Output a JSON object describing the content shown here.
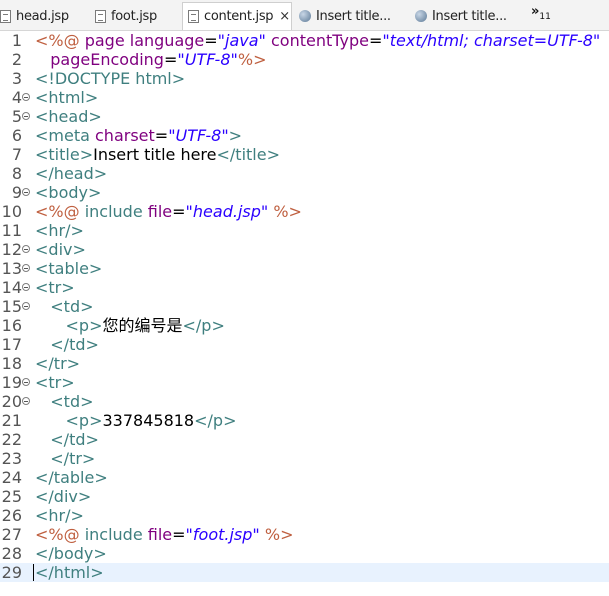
{
  "tabs": [
    {
      "label": "head.jsp",
      "icon": "jsp-file-icon",
      "active": false
    },
    {
      "label": "foot.jsp",
      "icon": "jsp-file-icon",
      "active": false
    },
    {
      "label": "content.jsp",
      "icon": "jsp-file-icon",
      "active": true,
      "close": "×"
    },
    {
      "label": "Insert title...",
      "icon": "browser-globe-icon",
      "active": false
    },
    {
      "label": "Insert title...",
      "icon": "browser-globe-icon",
      "active": false
    }
  ],
  "overflow": {
    "chevron": "»",
    "count": "11"
  },
  "lines": [
    {
      "n": "1",
      "fold": false,
      "tokens": [
        [
          "dir",
          "<%@ "
        ],
        [
          "at",
          "page "
        ],
        [
          "at",
          "language"
        ],
        [
          "txt",
          "="
        ],
        [
          "val",
          "\"java\""
        ],
        [
          "txt",
          " "
        ],
        [
          "at",
          "contentType"
        ],
        [
          "txt",
          "="
        ],
        [
          "val",
          "\"text/html; charset=UTF-8\""
        ]
      ]
    },
    {
      "n": "2",
      "fold": false,
      "tokens": [
        [
          "txt",
          "   "
        ],
        [
          "at",
          "pageEncoding"
        ],
        [
          "txt",
          "="
        ],
        [
          "val",
          "\"UTF-8\""
        ],
        [
          "dir",
          "%>"
        ]
      ]
    },
    {
      "n": "3",
      "fold": false,
      "tokens": [
        [
          "tg",
          "<!DOCTYPE html>"
        ]
      ]
    },
    {
      "n": "4",
      "fold": true,
      "tokens": [
        [
          "tg",
          "<html>"
        ]
      ]
    },
    {
      "n": "5",
      "fold": true,
      "tokens": [
        [
          "tg",
          "<head>"
        ]
      ]
    },
    {
      "n": "6",
      "fold": false,
      "tokens": [
        [
          "tg",
          "<meta "
        ],
        [
          "at",
          "charset"
        ],
        [
          "txt",
          "="
        ],
        [
          "val",
          "\"UTF-8\""
        ],
        [
          "tg",
          ">"
        ]
      ]
    },
    {
      "n": "7",
      "fold": false,
      "tokens": [
        [
          "tg",
          "<title>"
        ],
        [
          "txt",
          "Insert title here"
        ],
        [
          "tg",
          "</title>"
        ]
      ]
    },
    {
      "n": "8",
      "fold": false,
      "tokens": [
        [
          "tg",
          "</head>"
        ]
      ]
    },
    {
      "n": "9",
      "fold": true,
      "tokens": [
        [
          "tg",
          "<body>"
        ]
      ]
    },
    {
      "n": "10",
      "fold": false,
      "tokens": [
        [
          "dir",
          "<%@ "
        ],
        [
          "tg",
          "include "
        ],
        [
          "at",
          "file"
        ],
        [
          "txt",
          "="
        ],
        [
          "val",
          "\"head.jsp\""
        ],
        [
          "dir",
          " %>"
        ]
      ]
    },
    {
      "n": "11",
      "fold": false,
      "tokens": [
        [
          "tg",
          "<hr/>"
        ]
      ]
    },
    {
      "n": "12",
      "fold": true,
      "tokens": [
        [
          "tg",
          "<div>"
        ]
      ]
    },
    {
      "n": "13",
      "fold": true,
      "tokens": [
        [
          "tg",
          "<table>"
        ]
      ]
    },
    {
      "n": "14",
      "fold": true,
      "tokens": [
        [
          "tg",
          "<tr>"
        ]
      ]
    },
    {
      "n": "15",
      "fold": true,
      "tokens": [
        [
          "txt",
          "   "
        ],
        [
          "tg",
          "<td>"
        ]
      ]
    },
    {
      "n": "16",
      "fold": false,
      "tokens": [
        [
          "txt",
          "      "
        ],
        [
          "tg",
          "<p>"
        ],
        [
          "txt",
          "您的编号是"
        ],
        [
          "tg",
          "</p>"
        ]
      ]
    },
    {
      "n": "17",
      "fold": false,
      "tokens": [
        [
          "txt",
          "   "
        ],
        [
          "tg",
          "</td>"
        ]
      ]
    },
    {
      "n": "18",
      "fold": false,
      "tokens": [
        [
          "tg",
          "</tr>"
        ]
      ]
    },
    {
      "n": "19",
      "fold": true,
      "tokens": [
        [
          "tg",
          "<tr>"
        ]
      ]
    },
    {
      "n": "20",
      "fold": true,
      "tokens": [
        [
          "txt",
          "   "
        ],
        [
          "tg",
          "<td>"
        ]
      ]
    },
    {
      "n": "21",
      "fold": false,
      "tokens": [
        [
          "txt",
          "      "
        ],
        [
          "tg",
          "<p>"
        ],
        [
          "txt",
          "337845818"
        ],
        [
          "tg",
          "</p>"
        ]
      ]
    },
    {
      "n": "22",
      "fold": false,
      "tokens": [
        [
          "txt",
          "   "
        ],
        [
          "tg",
          "</td>"
        ]
      ]
    },
    {
      "n": "23",
      "fold": false,
      "tokens": [
        [
          "txt",
          "   "
        ],
        [
          "tg",
          "</tr>"
        ]
      ]
    },
    {
      "n": "24",
      "fold": false,
      "tokens": [
        [
          "tg",
          "</table>"
        ]
      ]
    },
    {
      "n": "25",
      "fold": false,
      "tokens": [
        [
          "tg",
          "</div>"
        ]
      ]
    },
    {
      "n": "26",
      "fold": false,
      "tokens": [
        [
          "tg",
          "<hr/>"
        ]
      ]
    },
    {
      "n": "27",
      "fold": false,
      "tokens": [
        [
          "dir",
          "<%@ "
        ],
        [
          "tg",
          "include "
        ],
        [
          "at",
          "file"
        ],
        [
          "txt",
          "="
        ],
        [
          "val",
          "\"foot.jsp\""
        ],
        [
          "dir",
          " %>"
        ]
      ]
    },
    {
      "n": "28",
      "fold": false,
      "tokens": [
        [
          "tg",
          "</body>"
        ]
      ]
    },
    {
      "n": "29",
      "fold": false,
      "current": true,
      "tokens": [
        [
          "tg",
          "</html>"
        ]
      ]
    }
  ],
  "colors": {
    "tag": "#3f7f7f",
    "attribute": "#7f007f",
    "value": "#2a00ff",
    "directive": "#bf5f3f",
    "current_line": "#e8f2fe"
  }
}
